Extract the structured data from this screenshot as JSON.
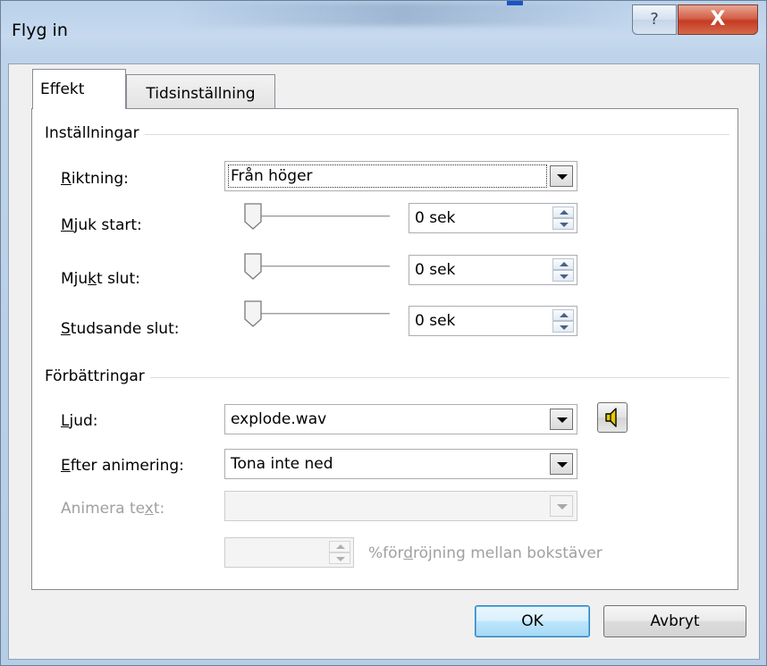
{
  "window": {
    "title": "Flyg in",
    "help_label": "?",
    "close_label": "X"
  },
  "tabs": [
    {
      "label": "Effekt",
      "active": true
    },
    {
      "label": "Tidsinställning",
      "active": false
    }
  ],
  "settings": {
    "group_label": "Inställningar",
    "direction": {
      "label_pre": "",
      "label_accel": "R",
      "label_post": "iktning:",
      "value": "Från höger"
    },
    "smooth_start": {
      "label_pre": "",
      "label_accel": "M",
      "label_post": "juk start:",
      "value": "0 sek",
      "slider_level": 0
    },
    "smooth_end": {
      "label_pre": "Mju",
      "label_accel": "k",
      "label_post": "t slut:",
      "value": "0 sek",
      "slider_level": 0
    },
    "bounce_end": {
      "label_pre": "",
      "label_accel": "S",
      "label_post": "tudsande slut:",
      "value": "0 sek",
      "slider_level": 0
    }
  },
  "enhancements": {
    "group_label": "Förbättringar",
    "sound": {
      "label_pre": "",
      "label_accel": "L",
      "label_post": "jud:",
      "value": "explode.wav"
    },
    "after_animation": {
      "label_pre": "",
      "label_accel": "E",
      "label_post": "fter animering:",
      "value": "Tona inte ned"
    },
    "animate_text": {
      "label_pre": "Animera te",
      "label_accel": "x",
      "label_post": "t:",
      "value": ""
    },
    "delay": {
      "value": "",
      "label_pre": "%för",
      "label_accel": "d",
      "label_post": "röjning mellan bokstäver"
    }
  },
  "buttons": {
    "ok": "OK",
    "cancel": "Avbryt"
  },
  "colors": {
    "title_bar": "#bed3e9",
    "close_button": "#c43b22",
    "default_button": "#bee6fd",
    "disabled_text": "#a0a0a0",
    "speaker_icon": "#e8c800"
  }
}
